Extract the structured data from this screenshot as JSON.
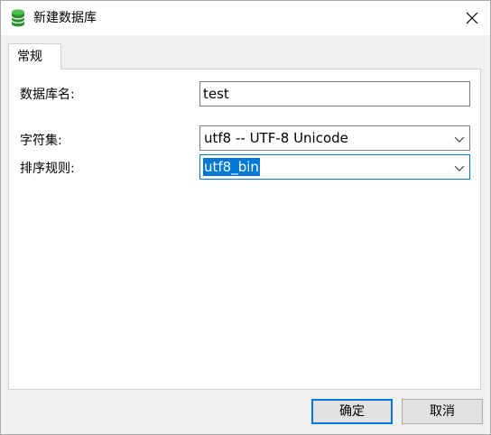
{
  "window": {
    "title": "新建数据库",
    "title_icon": "database-icon",
    "close_icon": "close-icon"
  },
  "tabs": [
    {
      "label": "常规",
      "active": true
    }
  ],
  "form": {
    "db_name": {
      "label": "数据库名:",
      "value": "test"
    },
    "charset": {
      "label": "字符集:",
      "value": "utf8 -- UTF-8 Unicode"
    },
    "collation": {
      "label": "排序规则:",
      "value": "utf8_bin"
    }
  },
  "buttons": {
    "ok": "确定",
    "cancel": "取消"
  },
  "colors": {
    "accent": "#0078d7",
    "icon_green": "#3ba53b"
  }
}
